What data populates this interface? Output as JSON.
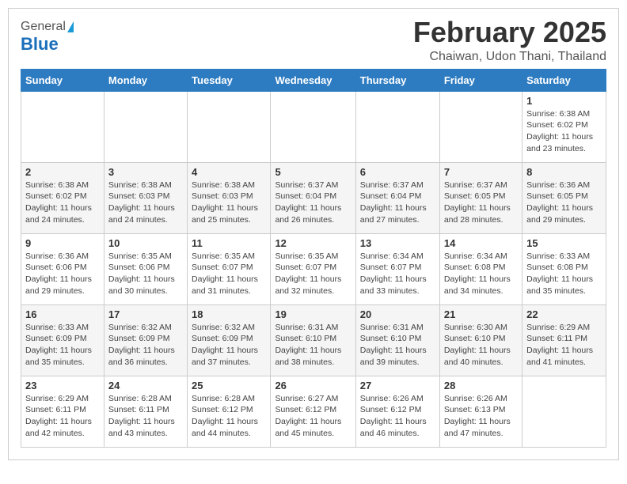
{
  "header": {
    "logo_general": "General",
    "logo_blue": "Blue",
    "month_title": "February 2025",
    "location": "Chaiwan, Udon Thani, Thailand"
  },
  "weekdays": [
    "Sunday",
    "Monday",
    "Tuesday",
    "Wednesday",
    "Thursday",
    "Friday",
    "Saturday"
  ],
  "weeks": [
    [
      null,
      null,
      null,
      null,
      null,
      null,
      {
        "day": 1,
        "sunrise": "6:38 AM",
        "sunset": "6:02 PM",
        "daylight": "11 hours and 23 minutes."
      }
    ],
    [
      {
        "day": 2,
        "sunrise": "6:38 AM",
        "sunset": "6:02 PM",
        "daylight": "11 hours and 24 minutes."
      },
      {
        "day": 3,
        "sunrise": "6:38 AM",
        "sunset": "6:03 PM",
        "daylight": "11 hours and 24 minutes."
      },
      {
        "day": 4,
        "sunrise": "6:38 AM",
        "sunset": "6:03 PM",
        "daylight": "11 hours and 25 minutes."
      },
      {
        "day": 5,
        "sunrise": "6:37 AM",
        "sunset": "6:04 PM",
        "daylight": "11 hours and 26 minutes."
      },
      {
        "day": 6,
        "sunrise": "6:37 AM",
        "sunset": "6:04 PM",
        "daylight": "11 hours and 27 minutes."
      },
      {
        "day": 7,
        "sunrise": "6:37 AM",
        "sunset": "6:05 PM",
        "daylight": "11 hours and 28 minutes."
      },
      {
        "day": 8,
        "sunrise": "6:36 AM",
        "sunset": "6:05 PM",
        "daylight": "11 hours and 29 minutes."
      }
    ],
    [
      {
        "day": 9,
        "sunrise": "6:36 AM",
        "sunset": "6:06 PM",
        "daylight": "11 hours and 29 minutes."
      },
      {
        "day": 10,
        "sunrise": "6:35 AM",
        "sunset": "6:06 PM",
        "daylight": "11 hours and 30 minutes."
      },
      {
        "day": 11,
        "sunrise": "6:35 AM",
        "sunset": "6:07 PM",
        "daylight": "11 hours and 31 minutes."
      },
      {
        "day": 12,
        "sunrise": "6:35 AM",
        "sunset": "6:07 PM",
        "daylight": "11 hours and 32 minutes."
      },
      {
        "day": 13,
        "sunrise": "6:34 AM",
        "sunset": "6:07 PM",
        "daylight": "11 hours and 33 minutes."
      },
      {
        "day": 14,
        "sunrise": "6:34 AM",
        "sunset": "6:08 PM",
        "daylight": "11 hours and 34 minutes."
      },
      {
        "day": 15,
        "sunrise": "6:33 AM",
        "sunset": "6:08 PM",
        "daylight": "11 hours and 35 minutes."
      }
    ],
    [
      {
        "day": 16,
        "sunrise": "6:33 AM",
        "sunset": "6:09 PM",
        "daylight": "11 hours and 35 minutes."
      },
      {
        "day": 17,
        "sunrise": "6:32 AM",
        "sunset": "6:09 PM",
        "daylight": "11 hours and 36 minutes."
      },
      {
        "day": 18,
        "sunrise": "6:32 AM",
        "sunset": "6:09 PM",
        "daylight": "11 hours and 37 minutes."
      },
      {
        "day": 19,
        "sunrise": "6:31 AM",
        "sunset": "6:10 PM",
        "daylight": "11 hours and 38 minutes."
      },
      {
        "day": 20,
        "sunrise": "6:31 AM",
        "sunset": "6:10 PM",
        "daylight": "11 hours and 39 minutes."
      },
      {
        "day": 21,
        "sunrise": "6:30 AM",
        "sunset": "6:10 PM",
        "daylight": "11 hours and 40 minutes."
      },
      {
        "day": 22,
        "sunrise": "6:29 AM",
        "sunset": "6:11 PM",
        "daylight": "11 hours and 41 minutes."
      }
    ],
    [
      {
        "day": 23,
        "sunrise": "6:29 AM",
        "sunset": "6:11 PM",
        "daylight": "11 hours and 42 minutes."
      },
      {
        "day": 24,
        "sunrise": "6:28 AM",
        "sunset": "6:11 PM",
        "daylight": "11 hours and 43 minutes."
      },
      {
        "day": 25,
        "sunrise": "6:28 AM",
        "sunset": "6:12 PM",
        "daylight": "11 hours and 44 minutes."
      },
      {
        "day": 26,
        "sunrise": "6:27 AM",
        "sunset": "6:12 PM",
        "daylight": "11 hours and 45 minutes."
      },
      {
        "day": 27,
        "sunrise": "6:26 AM",
        "sunset": "6:12 PM",
        "daylight": "11 hours and 46 minutes."
      },
      {
        "day": 28,
        "sunrise": "6:26 AM",
        "sunset": "6:13 PM",
        "daylight": "11 hours and 47 minutes."
      },
      null
    ]
  ]
}
